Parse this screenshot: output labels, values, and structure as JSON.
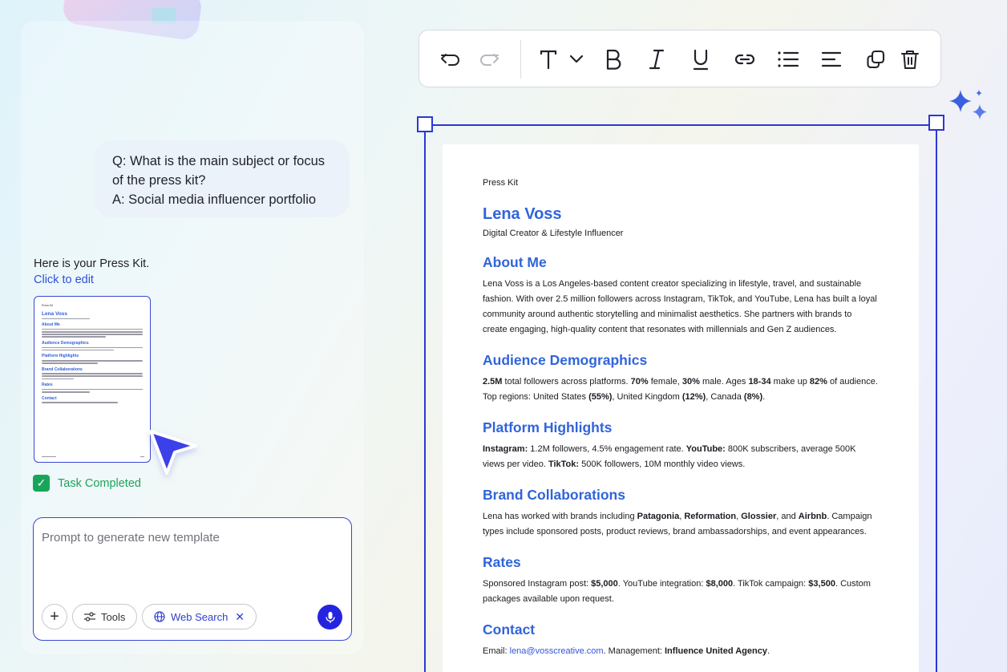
{
  "chat": {
    "question": "Q: What is the main subject or focus",
    "question_cont": "of the press kit?",
    "answer": "A: Social media influencer portfolio",
    "intro": "Here is your Press Kit.",
    "edit_link": "Click to edit",
    "task_status": "Task Completed"
  },
  "prompt": {
    "placeholder": "Prompt to generate new template",
    "tools_label": "Tools",
    "web_search_label": "Web Search"
  },
  "toolbar": {
    "icons": [
      "undo-icon",
      "redo-icon",
      "text-style-icon",
      "bold-icon",
      "italic-icon",
      "underline-icon",
      "link-icon",
      "list-icon",
      "align-icon",
      "duplicate-icon",
      "delete-icon"
    ]
  },
  "document": {
    "kit_label": "Press Kit",
    "name": "Lena Voss",
    "tagline": "Digital Creator & Lifestyle Influencer",
    "sections": {
      "about": {
        "heading": "About Me",
        "body": "Lena Voss is a Los Angeles-based content creator specializing in lifestyle, travel, and sustainable fashion. With over 2.5 million followers across Instagram, TikTok, and YouTube, Lena has built a loyal community around authentic storytelling and minimalist aesthetics. She partners with brands to create engaging, high-quality content that resonates with millennials and Gen Z audiences."
      },
      "audience": {
        "heading": "Audience Demographics",
        "t1": "2.5M",
        "t2": " total followers across platforms. ",
        "t3": "70%",
        "t4": " female, ",
        "t5": "30%",
        "t6": " male. Ages ",
        "t7": "18-34",
        "t8": " make up ",
        "t9": "82%",
        "t10": " of audience. Top regions: United States ",
        "t11": "(55%)",
        "t12": ", United Kingdom ",
        "t13": "(12%)",
        "t14": ", Canada ",
        "t15": "(8%)",
        "t16": "."
      },
      "platform": {
        "heading": "Platform Highlights",
        "t1": "Instagram:",
        "t2": " 1.2M followers, 4.5% engagement rate. ",
        "t3": "YouTube:",
        "t4": " 800K subscribers, average 500K views per video. ",
        "t5": "TikTok:",
        "t6": " 500K followers, 10M monthly video views."
      },
      "brands": {
        "heading": "Brand Collaborations",
        "t1": "Lena has worked with brands including ",
        "t2": "Patagonia",
        "t3": ", ",
        "t4": "Reformation",
        "t5": ", ",
        "t6": "Glossier",
        "t7": ", and ",
        "t8": "Airbnb",
        "t9": ". Campaign types include sponsored posts, product reviews, brand ambassadorships, and event appearances."
      },
      "rates": {
        "heading": "Rates",
        "t1": "Sponsored Instagram post: ",
        "t2": "$5,000",
        "t3": ". YouTube integration: ",
        "t4": "$8,000",
        "t5": ". TikTok campaign: ",
        "t6": "$3,500",
        "t7": ". Custom packages available upon request."
      },
      "contact": {
        "heading": "Contact",
        "t1": "Email: ",
        "email": "lena@vosscreative.com",
        "t2": ". Management: ",
        "agency": "Influence United Agency",
        "t3": "."
      }
    }
  },
  "colors": {
    "accent": "#2c37d8",
    "heading_blue": "#3064da",
    "success": "#17a659"
  }
}
